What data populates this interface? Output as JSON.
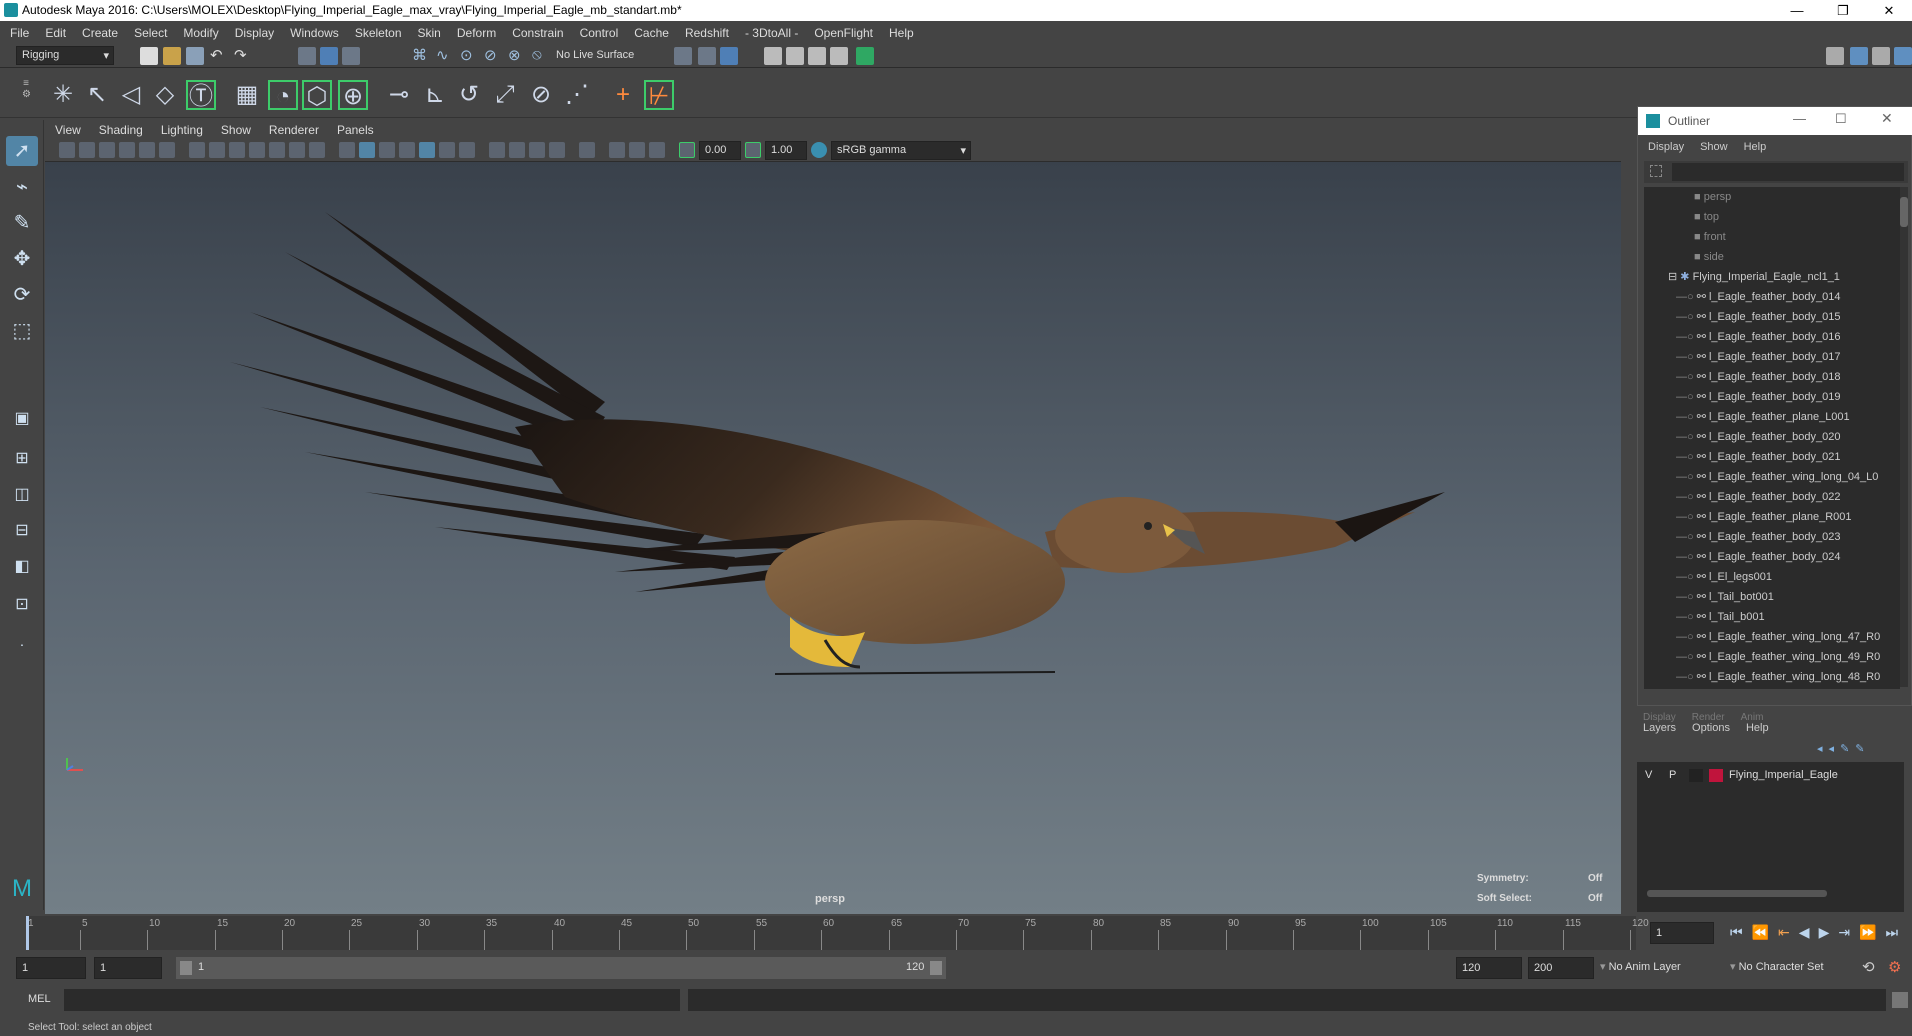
{
  "window": {
    "title": "Autodesk Maya 2016: C:\\Users\\MOLEX\\Desktop\\Flying_Imperial_Eagle_max_vray\\Flying_Imperial_Eagle_mb_standart.mb*",
    "minimize": "—",
    "restore": "❐",
    "close": "✕"
  },
  "menubar": [
    "File",
    "Edit",
    "Create",
    "Select",
    "Modify",
    "Display",
    "Windows",
    "Skeleton",
    "Skin",
    "Deform",
    "Constrain",
    "Control",
    "Cache",
    "Redshift",
    "- 3DtoAll -",
    "OpenFlight",
    "Help"
  ],
  "statusline": {
    "mode": "Rigging",
    "live_surface": "No Live Surface"
  },
  "viewport": {
    "menus": [
      "View",
      "Shading",
      "Lighting",
      "Show",
      "Renderer",
      "Panels"
    ],
    "field1": "0.00",
    "field2": "1.00",
    "color_space": "sRGB gamma",
    "camera_label": "persp",
    "symmetry_label": "Symmetry:",
    "symmetry_value": "Off",
    "soft_select_label": "Soft Select:",
    "soft_select_value": "Off"
  },
  "outliner": {
    "title": "Outliner",
    "menus": [
      "Display",
      "Show",
      "Help"
    ],
    "cameras": [
      "persp",
      "top",
      "front",
      "side"
    ],
    "group": "Flying_Imperial_Eagle_ncl1_1",
    "items": [
      "l_Eagle_feather_body_014",
      "l_Eagle_feather_body_015",
      "l_Eagle_feather_body_016",
      "l_Eagle_feather_body_017",
      "l_Eagle_feather_body_018",
      "l_Eagle_feather_body_019",
      "l_Eagle_feather_plane_L001",
      "l_Eagle_feather_body_020",
      "l_Eagle_feather_body_021",
      "l_Eagle_feather_wing_long_04_L0",
      "l_Eagle_feather_body_022",
      "l_Eagle_feather_plane_R001",
      "l_Eagle_feather_body_023",
      "l_Eagle_feather_body_024",
      "l_El_legs001",
      "l_Tail_bot001",
      "l_Tail_b001",
      "l_Eagle_feather_wing_long_47_R0",
      "l_Eagle_feather_wing_long_49_R0",
      "l_Eagle_feather_wing_long_48_R0"
    ]
  },
  "layers": {
    "tabs": [
      "Display",
      "Render",
      "Anim"
    ],
    "menus": [
      "Layers",
      "Options",
      "Help"
    ],
    "row": {
      "v": "V",
      "p": "P",
      "name": "Flying_Imperial_Eagle",
      "color": "#c0143c"
    }
  },
  "timeline": {
    "ticks": [
      "1",
      "5",
      "10",
      "15",
      "20",
      "25",
      "30",
      "35",
      "40",
      "45",
      "50",
      "55",
      "60",
      "65",
      "70",
      "75",
      "80",
      "85",
      "90",
      "95",
      "100",
      "105",
      "110",
      "115",
      "120"
    ],
    "current_frame": "1"
  },
  "range": {
    "start": "1",
    "anim_start": "1",
    "slider_start": "1",
    "slider_end": "120",
    "end": "120",
    "anim_end": "200",
    "anim_layer": "No Anim Layer",
    "character_set": "No Character Set"
  },
  "command": {
    "label": "MEL"
  },
  "help": {
    "text": "Select Tool: select an object"
  },
  "colors": {
    "ui_bg": "#444444",
    "viewport_top": "#39414b",
    "viewport_bottom": "#737f87",
    "layer_color": "#c0143c",
    "accent_green": "#3dcc6a"
  }
}
